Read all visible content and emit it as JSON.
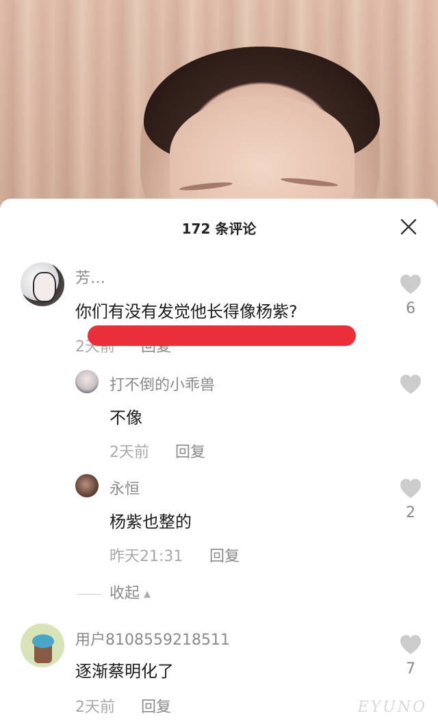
{
  "sheet": {
    "title": "172 条评论"
  },
  "comments": [
    {
      "username": "芳…",
      "text": "你们有没有发觉他长得像杨紫?",
      "time": "2天前",
      "reply_label": "回复",
      "likes": "6"
    }
  ],
  "replies": [
    {
      "username": "打不倒的小乖兽",
      "text": "不像",
      "time": "2天前",
      "reply_label": "回复",
      "likes": ""
    },
    {
      "username": "永恒",
      "text": "杨紫也整的",
      "time": "昨天21:31",
      "reply_label": "回复",
      "likes": "2"
    }
  ],
  "collapse_label": "收起",
  "comment2": {
    "username": "用户8108559218511",
    "text": "逐渐蔡明化了",
    "time": "2天前",
    "reply_label": "回复",
    "likes": "7"
  },
  "watermark": "EYUNO",
  "colors": {
    "accent_red": "#ea2e3a",
    "like_gray": "#cccccc"
  },
  "icons": [
    "close-icon",
    "heart-icon",
    "triangle-up-icon"
  ]
}
